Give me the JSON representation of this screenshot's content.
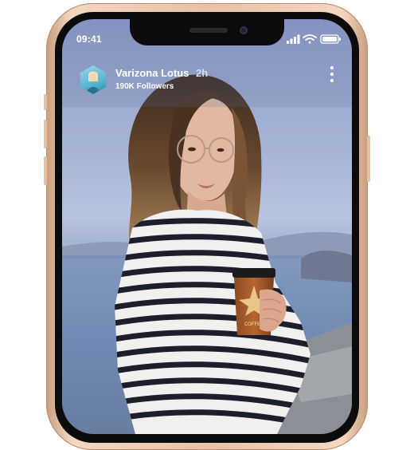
{
  "status_bar": {
    "time": "09:41",
    "icons": [
      "signal-icon",
      "wifi-icon",
      "battery-icon"
    ]
  },
  "post": {
    "author": "Varizona Lotus",
    "time_ago": "2h",
    "followers": "190K Followers",
    "more_icon": "more-vertical-icon",
    "cup_brand": "COFFEE"
  },
  "colors": {
    "frame": "#e8c2a6",
    "bezel": "#0c0c0d",
    "text": "#ffffff",
    "time_ago": "#d8dcee"
  }
}
